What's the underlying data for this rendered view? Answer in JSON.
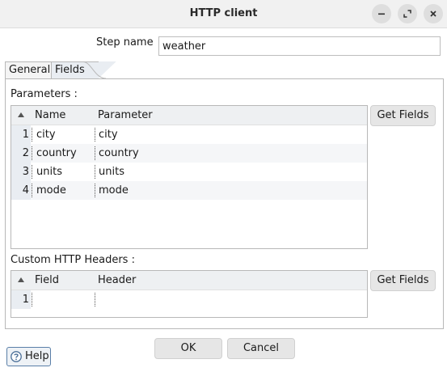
{
  "window": {
    "title": "HTTP client",
    "minimize_label": "−",
    "close_label": "✕"
  },
  "step": {
    "label": "Step name",
    "value": "weather"
  },
  "tabs": [
    {
      "label": "General",
      "active": false
    },
    {
      "label": "Fields",
      "active": true
    }
  ],
  "parameters": {
    "label": "Parameters :",
    "columns": [
      "Name",
      "Parameter"
    ],
    "rows": [
      {
        "num": "1",
        "name": "city",
        "parameter": "city"
      },
      {
        "num": "2",
        "name": "country",
        "parameter": "country"
      },
      {
        "num": "3",
        "name": "units",
        "parameter": "units"
      },
      {
        "num": "4",
        "name": "mode",
        "parameter": "mode"
      }
    ],
    "get_fields_label": "Get Fields"
  },
  "headers": {
    "label": "Custom HTTP Headers :",
    "columns": [
      "Field",
      "Header"
    ],
    "rows": [
      {
        "num": "1",
        "field": "",
        "header": ""
      }
    ],
    "get_fields_label": "Get Fields"
  },
  "actions": {
    "ok_label": "OK",
    "cancel_label": "Cancel",
    "help_label": "Help"
  },
  "colors": {
    "titlebar": "#f1f1f1",
    "rownum_bg": "#e9edf2",
    "help_border": "#5a7fa8"
  }
}
